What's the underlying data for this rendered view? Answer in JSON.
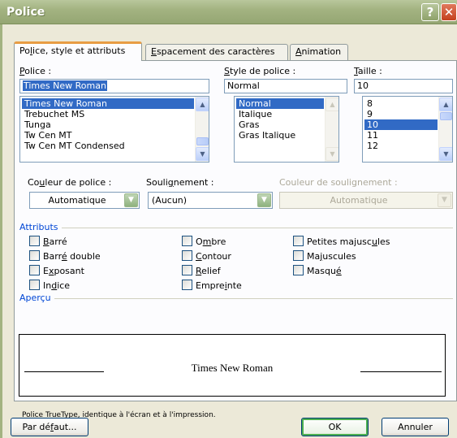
{
  "window": {
    "title": "Police"
  },
  "titlebar": {
    "help_glyph": "?",
    "close_glyph": "✕"
  },
  "tabs": [
    {
      "label": "Police, style et attributs",
      "active": true
    },
    {
      "label": "Espacement des caractères",
      "active": false
    },
    {
      "label": "Animation",
      "active": false
    }
  ],
  "font": {
    "label": "Police :",
    "value": "Times New Roman",
    "items": [
      "Times New Roman",
      "Trebuchet MS",
      "Tunga",
      "Tw Cen MT",
      "Tw Cen MT Condensed"
    ],
    "selected_index": 0
  },
  "style": {
    "label": "Style de police :",
    "value": "Normal",
    "items": [
      "Normal",
      "Italique",
      "Gras",
      "Gras Italique"
    ],
    "selected_index": 0
  },
  "size": {
    "label": "Taille :",
    "value": "10",
    "items": [
      "8",
      "9",
      "10",
      "11",
      "12"
    ],
    "selected_index": 2
  },
  "font_color": {
    "label": "Couleur de police :",
    "value": "Automatique"
  },
  "underline": {
    "label": "Soulignement :",
    "value": "(Aucun)"
  },
  "underline_color": {
    "label": "Couleur de soulignement :",
    "value": "Automatique"
  },
  "attributes": {
    "label": "Attributs",
    "col1": [
      "Barré",
      "Barré double",
      "Exposant",
      "Indice"
    ],
    "col2": [
      "Ombre",
      "Contour",
      "Relief",
      "Empreinte"
    ],
    "col3": [
      "Petites majuscules",
      "Majuscules",
      "Masqué"
    ]
  },
  "preview": {
    "label": "Aperçu",
    "sample": "Times New Roman"
  },
  "note": "Police TrueType, identique à l'écran et à l'impression.",
  "buttons": {
    "default": "Par défaut...",
    "ok": "OK",
    "cancel": "Annuler"
  },
  "colors": {
    "accent_tab": "#e89d44",
    "selection": "#316ac5",
    "group_label": "#0046d5"
  }
}
